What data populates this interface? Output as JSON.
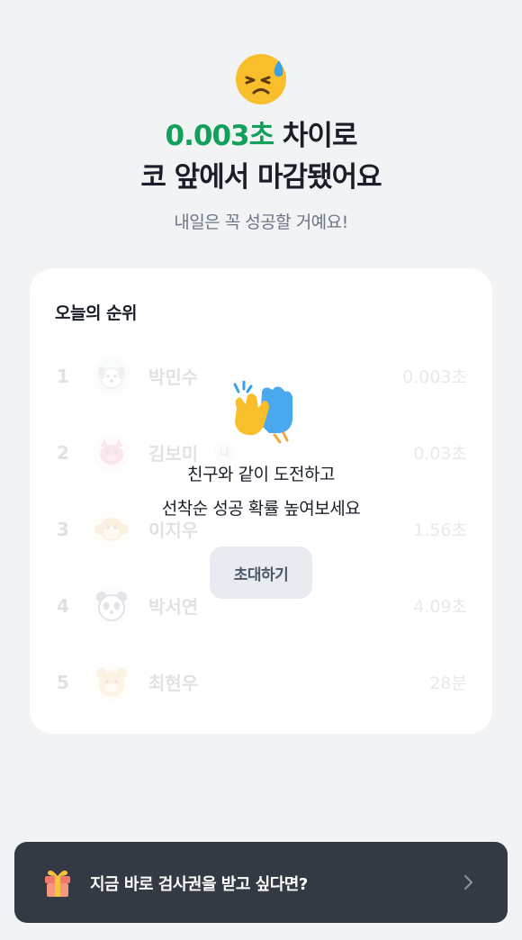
{
  "result": {
    "emoji": "sweat-face-icon",
    "headline_accent": "0.003초",
    "headline_line1_rest": " 차이로",
    "headline_line2": "코 앞에서 마감됐어요",
    "subline": "내일은 꼭 성공할 거예요!"
  },
  "ranking": {
    "title": "오늘의 순위",
    "rows": [
      {
        "rank": "1",
        "name": "박민수",
        "time": "0.003초",
        "avatar": "dog-avatar-icon",
        "me": ""
      },
      {
        "rank": "2",
        "name": "김보미",
        "time": "0.03초",
        "avatar": "pig-avatar-icon",
        "me": "나"
      },
      {
        "rank": "3",
        "name": "이지우",
        "time": "1.56초",
        "avatar": "monkey-avatar-icon",
        "me": ""
      },
      {
        "rank": "4",
        "name": "박서연",
        "time": "4.09초",
        "avatar": "panda-avatar-icon",
        "me": ""
      },
      {
        "rank": "5",
        "name": "최현우",
        "time": "28분",
        "avatar": "bear-avatar-icon",
        "me": ""
      }
    ],
    "overlay": {
      "emoji": "high-five-icon",
      "line1": "친구와 같이 도전하고",
      "line2": "선착순 성공 확률 높여보세요",
      "invite_label": "초대하기"
    }
  },
  "banner": {
    "icon": "gift-icon",
    "text": "지금 바로 검사권을 받고 싶다면?"
  },
  "colors": {
    "accent": "#12a05a",
    "background": "#f2f3f5",
    "banner": "#333a44"
  }
}
